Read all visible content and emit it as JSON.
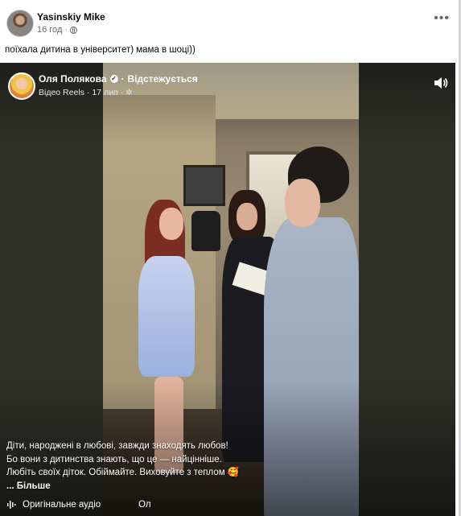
{
  "post": {
    "author": "Yasinskiy Mike",
    "time": "16 год",
    "text": "поїхала дитина в університет) мама в шоці))",
    "more_menu": "•••"
  },
  "reel": {
    "author": "Оля Полякова",
    "follow_status": "Відстежується",
    "separator": "·",
    "source": "Відео Reels",
    "date": "17 лип",
    "caption_lines": [
      "Діти, народжені в любові, завжди знаходять любов!",
      "Бо вони з дитинства знають, що це — найцінніше.",
      "Любіть своїх діток. Обіймайте. Виховуйте з теплом"
    ],
    "caption_emoji": "🥰",
    "more_label": "... Більше",
    "audio_label": "Оригінальне аудіо",
    "audio_author_truncated": "Ол"
  },
  "icons": {
    "privacy": "globe-icon",
    "verified": "verified-badge-icon",
    "settings": "gear-icon",
    "volume": "volume-icon",
    "audio": "audio-wave-icon"
  },
  "colors": {
    "text_primary": "#050505",
    "text_secondary": "#65676b",
    "video_bg": "#2f3029"
  }
}
